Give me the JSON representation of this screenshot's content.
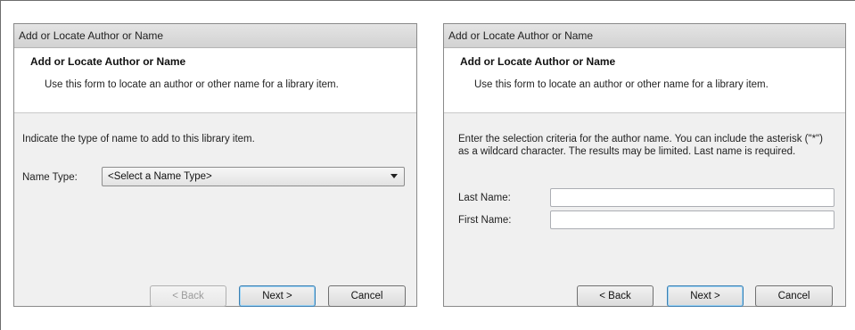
{
  "left_dialog": {
    "title": "Add or Locate Author or Name",
    "header_title": "Add or Locate Author or Name",
    "header_subtitle": "Use this form to locate an author or other name for a library item.",
    "instruction": "Indicate the type of name to add to this library item.",
    "name_type_label": "Name Type:",
    "name_type_value": "<Select a Name Type>",
    "buttons": {
      "back": "< Back",
      "next": "Next >",
      "cancel": "Cancel"
    }
  },
  "right_dialog": {
    "title": "Add or Locate Author or Name",
    "header_title": "Add or Locate Author or Name",
    "header_subtitle": "Use this form to locate an author or other name for a library item.",
    "instruction": "Enter the selection criteria for the author name. You can include the asterisk (\"*\") as a wildcard character. The results may be limited. Last name is required.",
    "last_name_label": "Last Name:",
    "last_name_value": "",
    "first_name_label": "First Name:",
    "first_name_value": "",
    "buttons": {
      "back": "< Back",
      "next": "Next >",
      "cancel": "Cancel"
    }
  }
}
